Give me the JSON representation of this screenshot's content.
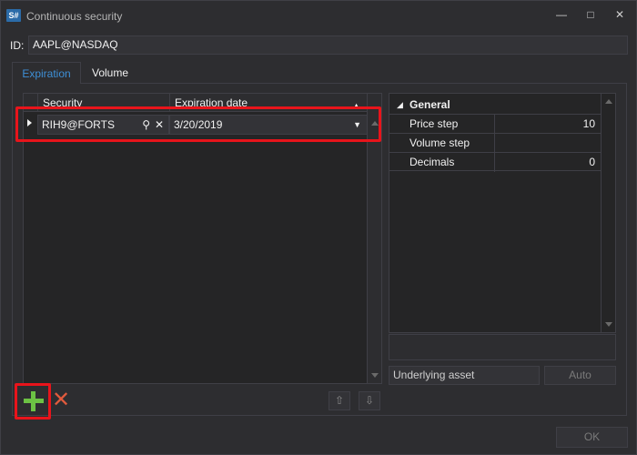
{
  "window": {
    "title": "Continuous security",
    "app_icon_text": "S#",
    "minimize_glyph": "—",
    "maximize_glyph": "□",
    "close_glyph": "✕"
  },
  "id_row": {
    "label": "ID:",
    "value": "AAPL@NASDAQ"
  },
  "tabs": [
    {
      "label": "Expiration",
      "active": true
    },
    {
      "label": "Volume",
      "active": false
    }
  ],
  "grid": {
    "columns": [
      "Security",
      "Expiration date"
    ],
    "rows": [
      {
        "security": "RIH9@FORTS",
        "expiration_date": "3/20/2019"
      }
    ]
  },
  "properties": {
    "category": "General",
    "items": [
      {
        "name": "Price step",
        "value": "10"
      },
      {
        "name": "Volume step",
        "value": ""
      },
      {
        "name": "Decimals",
        "value": "0"
      }
    ]
  },
  "underlying": {
    "value": "Underlying asset"
  },
  "buttons": {
    "auto": "Auto",
    "ok": "OK",
    "move_up_glyph": "⇧",
    "move_down_glyph": "⇩",
    "delete_glyph": "✕"
  },
  "colors": {
    "accent": "#3e8fd6",
    "highlight": "#e8141b",
    "add_green": "#6cc144",
    "delete_red": "#e05a3d",
    "background": "#2d2d30"
  }
}
